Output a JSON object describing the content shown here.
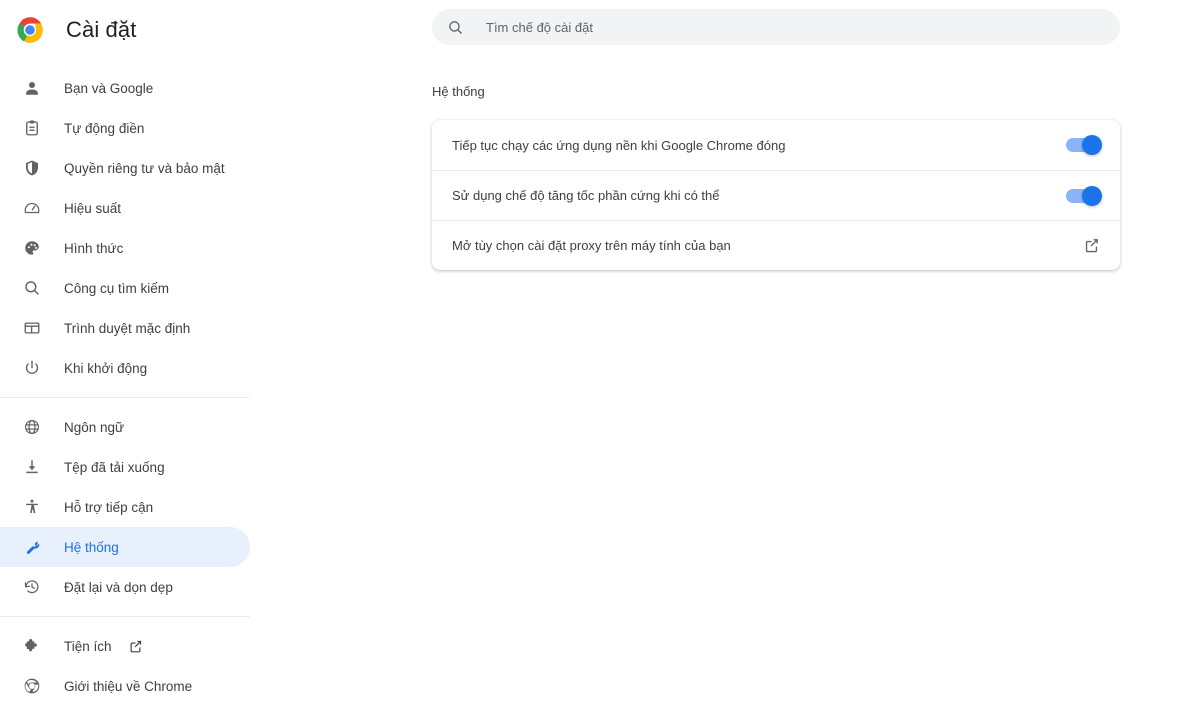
{
  "app": {
    "title": "Cài đặt",
    "logo_icon": "chrome-logo"
  },
  "search": {
    "placeholder": "Tìm chế độ cài đặt",
    "value": "",
    "icon": "search-icon"
  },
  "sidebar": {
    "groups": [
      {
        "items": [
          {
            "label": "Bạn và Google",
            "icon": "person-icon",
            "active": false
          },
          {
            "label": "Tự động điền",
            "icon": "clipboard-icon",
            "active": false
          },
          {
            "label": "Quyền riêng tư và bảo mật",
            "icon": "shield-icon",
            "active": false
          },
          {
            "label": "Hiệu suất",
            "icon": "speedometer-icon",
            "active": false
          },
          {
            "label": "Hình thức",
            "icon": "palette-icon",
            "active": false
          },
          {
            "label": "Công cụ tìm kiếm",
            "icon": "search-icon",
            "active": false
          },
          {
            "label": "Trình duyệt mặc định",
            "icon": "browser-window-icon",
            "active": false
          },
          {
            "label": "Khi khởi động",
            "icon": "power-icon",
            "active": false
          }
        ]
      },
      {
        "items": [
          {
            "label": "Ngôn ngữ",
            "icon": "globe-icon",
            "active": false
          },
          {
            "label": "Tệp đã tải xuống",
            "icon": "download-icon",
            "active": false
          },
          {
            "label": "Hỗ trợ tiếp cận",
            "icon": "accessibility-icon",
            "active": false
          },
          {
            "label": "Hệ thống",
            "icon": "wrench-icon",
            "active": true
          },
          {
            "label": "Đặt lại và dọn dẹp",
            "icon": "history-restore-icon",
            "active": false
          }
        ]
      },
      {
        "items": [
          {
            "label": "Tiện ích",
            "icon": "puzzle-piece-icon",
            "active": false,
            "external": true
          },
          {
            "label": "Giới thiệu về Chrome",
            "icon": "chrome-outline-icon",
            "active": false
          }
        ]
      }
    ]
  },
  "main": {
    "section_heading": "Hệ thống",
    "rows": [
      {
        "label": "Tiếp tục chạy các ứng dụng nền khi Google Chrome đóng",
        "control": "toggle",
        "state": "on"
      },
      {
        "label": "Sử dụng chế độ tăng tốc phần cứng khi có thể",
        "control": "toggle",
        "state": "on"
      },
      {
        "label": "Mở tùy chọn cài đặt proxy trên máy tính của bạn",
        "control": "external-link",
        "state": ""
      }
    ]
  },
  "colors": {
    "accent": "#1a73e8",
    "toggle_track": "#8ab4f8",
    "active_pill": "#e8f0fe",
    "text_primary": "#3c4043",
    "icon": "#5f6368",
    "search_bg": "#f1f3f4",
    "divider": "#e8eaed"
  }
}
